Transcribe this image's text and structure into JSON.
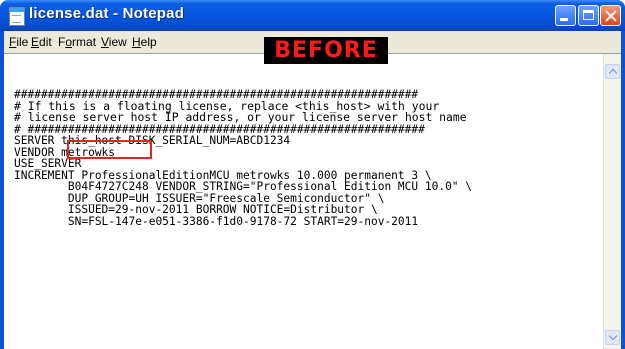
{
  "window": {
    "title": "license.dat - Notepad"
  },
  "menu": {
    "items": [
      {
        "accel": "F",
        "rest": "ile"
      },
      {
        "accel": "E",
        "rest": "dit"
      },
      {
        "accel": "",
        "pre": "F",
        "accel2": "o",
        "rest": "rmat"
      },
      {
        "accel": "V",
        "rest": "iew"
      },
      {
        "accel": "H",
        "rest": "elp"
      }
    ]
  },
  "annotation": {
    "badge": "BEFORE"
  },
  "document": {
    "lines": [
      "############################################################",
      "# If this is a floating license, replace <this_host> with your",
      "# license server host IP address, or your license server host name",
      "# ###########################################################",
      "SERVER this_host DISK_SERIAL_NUM=ABCD1234",
      "VENDOR metrowks",
      "USE_SERVER",
      "INCREMENT ProfessionalEditionMCU metrowks 10.000 permanent 3 \\",
      "        B04F4727C248 VENDOR_STRING=\"Professional Edition MCU 10.0\" \\",
      "        DUP_GROUP=UH ISSUER=\"Freescale Semiconductor\" \\",
      "        ISSUED=29-nov-2011 BORROW NOTICE=Distributor \\",
      "        SN=FSL-147e-e051-3386-f1d0-9178-72 START=29-nov-2011"
    ],
    "highlighted_token": "this_host"
  }
}
